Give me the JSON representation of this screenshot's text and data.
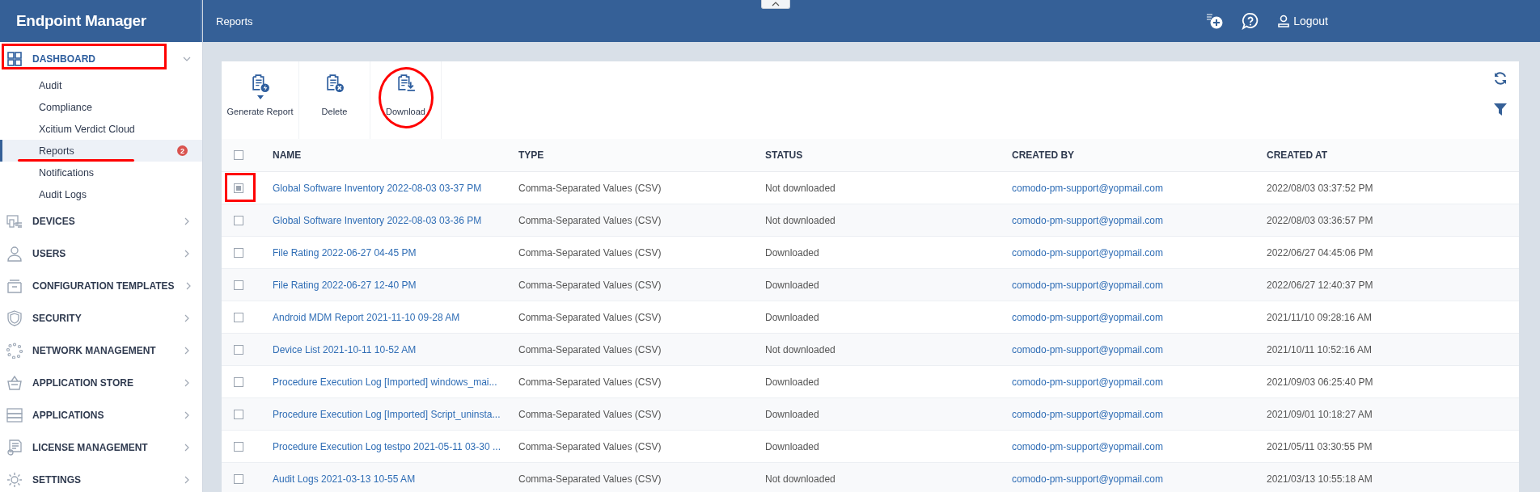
{
  "sidebar": {
    "title": "Endpoint Manager",
    "items": [
      {
        "label": "DASHBOARD",
        "expanded": true,
        "highlighted": true,
        "children": [
          {
            "label": "Audit",
            "selected": false
          },
          {
            "label": "Compliance",
            "selected": false
          },
          {
            "label": "Xcitium Verdict Cloud",
            "selected": false
          },
          {
            "label": "Reports",
            "selected": true,
            "badge": "2",
            "highlighted": true
          },
          {
            "label": "Notifications",
            "selected": false
          },
          {
            "label": "Audit Logs",
            "selected": false
          }
        ]
      },
      {
        "label": "DEVICES",
        "expanded": false
      },
      {
        "label": "USERS",
        "expanded": false
      },
      {
        "label": "CONFIGURATION TEMPLATES",
        "expanded": false
      },
      {
        "label": "SECURITY",
        "expanded": false
      },
      {
        "label": "NETWORK MANAGEMENT",
        "expanded": false
      },
      {
        "label": "APPLICATION STORE",
        "expanded": false
      },
      {
        "label": "APPLICATIONS",
        "expanded": false
      },
      {
        "label": "LICENSE MANAGEMENT",
        "expanded": false
      },
      {
        "label": "SETTINGS",
        "expanded": false
      }
    ]
  },
  "header": {
    "page_title": "Reports",
    "logout": "Logout"
  },
  "toolbar": {
    "buttons": [
      {
        "label": "Generate Report",
        "kind": "generate"
      },
      {
        "label": "Delete",
        "kind": "delete"
      },
      {
        "label": "Download",
        "kind": "download",
        "highlighted": true
      }
    ]
  },
  "table": {
    "header_checked": false,
    "columns": [
      "NAME",
      "TYPE",
      "STATUS",
      "CREATED BY",
      "CREATED AT"
    ],
    "rows": [
      {
        "checked": true,
        "highlighted": true,
        "cells": [
          "Global Software Inventory 2022-08-03 03-37 PM",
          "Comma-Separated Values (CSV)",
          "Not downloaded",
          "comodo-pm-support@yopmail.com",
          "2022/08/03 03:37:52 PM"
        ]
      },
      {
        "checked": false,
        "cells": [
          "Global Software Inventory 2022-08-03 03-36 PM",
          "Comma-Separated Values (CSV)",
          "Not downloaded",
          "comodo-pm-support@yopmail.com",
          "2022/08/03 03:36:57 PM"
        ]
      },
      {
        "checked": false,
        "cells": [
          "File Rating 2022-06-27 04-45 PM",
          "Comma-Separated Values (CSV)",
          "Downloaded",
          "comodo-pm-support@yopmail.com",
          "2022/06/27 04:45:06 PM"
        ]
      },
      {
        "checked": false,
        "cells": [
          "File Rating 2022-06-27 12-40 PM",
          "Comma-Separated Values (CSV)",
          "Downloaded",
          "comodo-pm-support@yopmail.com",
          "2022/06/27 12:40:37 PM"
        ]
      },
      {
        "checked": false,
        "cells": [
          "Android MDM Report 2021-11-10 09-28 AM",
          "Comma-Separated Values (CSV)",
          "Downloaded",
          "comodo-pm-support@yopmail.com",
          "2021/11/10 09:28:16 AM"
        ]
      },
      {
        "checked": false,
        "cells": [
          "Device List 2021-10-11 10-52 AM",
          "Comma-Separated Values (CSV)",
          "Not downloaded",
          "comodo-pm-support@yopmail.com",
          "2021/10/11 10:52:16 AM"
        ]
      },
      {
        "checked": false,
        "cells": [
          "Procedure Execution Log [Imported] windows_mai...",
          "Comma-Separated Values (CSV)",
          "Downloaded",
          "comodo-pm-support@yopmail.com",
          "2021/09/03 06:25:40 PM"
        ]
      },
      {
        "checked": false,
        "cells": [
          "Procedure Execution Log [Imported] Script_uninsta...",
          "Comma-Separated Values (CSV)",
          "Downloaded",
          "comodo-pm-support@yopmail.com",
          "2021/09/01 10:18:27 AM"
        ]
      },
      {
        "checked": false,
        "cells": [
          "Procedure Execution Log testpo 2021-05-11 03-30 ...",
          "Comma-Separated Values (CSV)",
          "Downloaded",
          "comodo-pm-support@yopmail.com",
          "2021/05/11 03:30:55 PM"
        ]
      },
      {
        "checked": false,
        "cells": [
          "Audit Logs 2021-03-13 10-55 AM",
          "Comma-Separated Values (CSV)",
          "Not downloaded",
          "comodo-pm-support@yopmail.com",
          "2021/03/13 10:55:18 AM"
        ]
      }
    ]
  }
}
